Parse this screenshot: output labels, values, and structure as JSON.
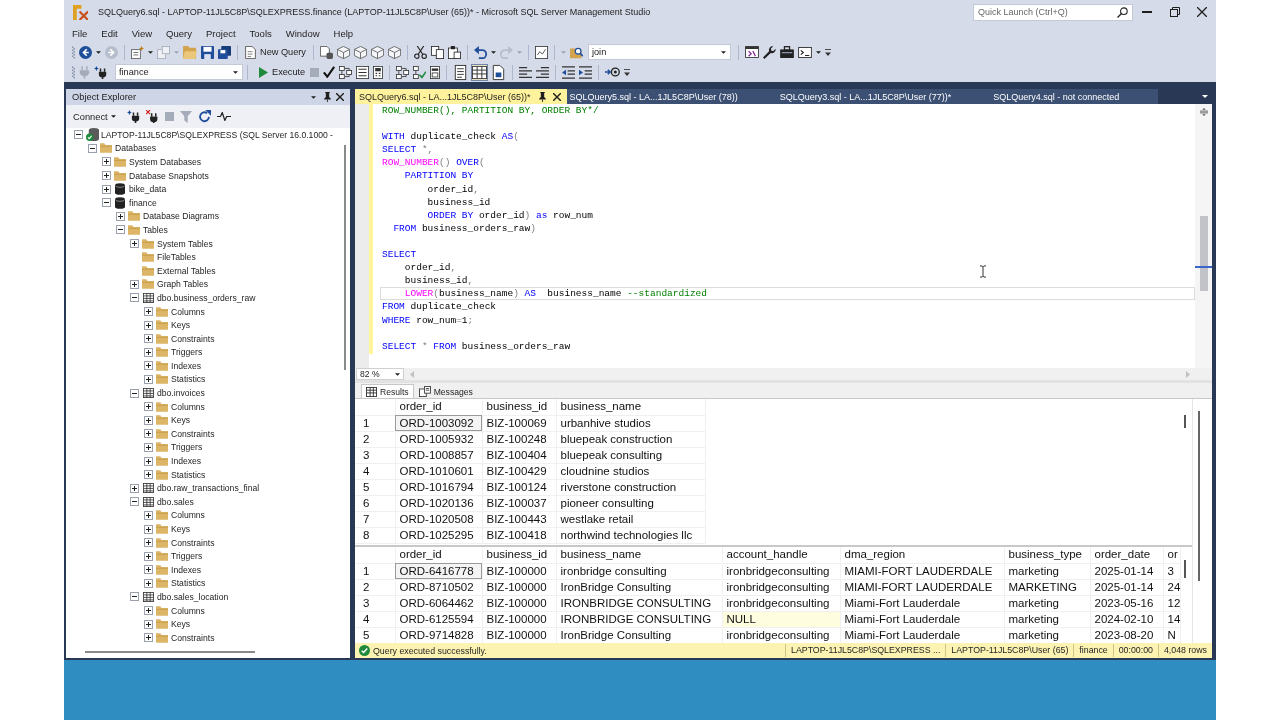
{
  "window": {
    "title": "SQLQuery6.sql - LAPTOP-11JL5C8P\\SQLEXPRESS.finance (LAPTOP-11JL5C8P\\User (65))* - Microsoft SQL Server Management Studio",
    "quick_launch": {
      "placeholder": "Quick Launch (Ctrl+Q)"
    }
  },
  "menu": [
    "File",
    "Edit",
    "View",
    "Query",
    "Project",
    "Tools",
    "Window",
    "Help"
  ],
  "toolbar_1": {
    "new_query_button": "New Query",
    "search_combo": {
      "value": "join"
    }
  },
  "toolbar_2": {
    "database_combo": {
      "value": "finance"
    },
    "execute_button": "Execute",
    "output_modes": [
      {
        "selected": false
      },
      {
        "selected": true
      },
      {
        "selected": false
      }
    ]
  },
  "object_explorer": {
    "title": "Object Explorer",
    "connect_button": "Connect",
    "tree": [
      {
        "label": "LAPTOP-11JL5C8P\\SQLEXPRESS (SQL Server 16.0.1000 -",
        "kind": "server",
        "expanded": true,
        "children": [
          {
            "label": "Databases",
            "kind": "folder",
            "expanded": true,
            "children": [
              {
                "label": "System Databases",
                "kind": "folder",
                "expanded": false
              },
              {
                "label": "Database Snapshots",
                "kind": "folder",
                "expanded": false
              },
              {
                "label": "bike_data",
                "kind": "database",
                "expanded": false
              },
              {
                "label": "finance",
                "kind": "database",
                "expanded": true,
                "children": [
                  {
                    "label": "Database Diagrams",
                    "kind": "folder",
                    "expanded": false
                  },
                  {
                    "label": "Tables",
                    "kind": "folder",
                    "expanded": true,
                    "children": [
                      {
                        "label": "System Tables",
                        "kind": "folder",
                        "expanded": false
                      },
                      {
                        "label": "FileTables",
                        "kind": "folder"
                      },
                      {
                        "label": "External Tables",
                        "kind": "folder"
                      },
                      {
                        "label": "Graph Tables",
                        "kind": "folder",
                        "expanded": false
                      },
                      {
                        "label": "dbo.business_orders_raw",
                        "kind": "table",
                        "expanded": true,
                        "children": [
                          {
                            "label": "Columns",
                            "kind": "folder",
                            "expanded": false
                          },
                          {
                            "label": "Keys",
                            "kind": "folder",
                            "expanded": false
                          },
                          {
                            "label": "Constraints",
                            "kind": "folder",
                            "expanded": false
                          },
                          {
                            "label": "Triggers",
                            "kind": "folder",
                            "expanded": false
                          },
                          {
                            "label": "Indexes",
                            "kind": "folder",
                            "expanded": false
                          },
                          {
                            "label": "Statistics",
                            "kind": "folder",
                            "expanded": false
                          }
                        ]
                      },
                      {
                        "label": "dbo.invoices",
                        "kind": "table",
                        "expanded": true,
                        "children": [
                          {
                            "label": "Columns",
                            "kind": "folder",
                            "expanded": false
                          },
                          {
                            "label": "Keys",
                            "kind": "folder",
                            "expanded": false
                          },
                          {
                            "label": "Constraints",
                            "kind": "folder",
                            "expanded": false
                          },
                          {
                            "label": "Triggers",
                            "kind": "folder",
                            "expanded": false
                          },
                          {
                            "label": "Indexes",
                            "kind": "folder",
                            "expanded": false
                          },
                          {
                            "label": "Statistics",
                            "kind": "folder",
                            "expanded": false
                          }
                        ]
                      },
                      {
                        "label": "dbo.raw_transactions_final",
                        "kind": "table",
                        "expanded": false
                      },
                      {
                        "label": "dbo.sales",
                        "kind": "table",
                        "expanded": true,
                        "children": [
                          {
                            "label": "Columns",
                            "kind": "folder",
                            "expanded": false
                          },
                          {
                            "label": "Keys",
                            "kind": "folder",
                            "expanded": false
                          },
                          {
                            "label": "Constraints",
                            "kind": "folder",
                            "expanded": false
                          },
                          {
                            "label": "Triggers",
                            "kind": "folder",
                            "expanded": false
                          },
                          {
                            "label": "Indexes",
                            "kind": "folder",
                            "expanded": false
                          },
                          {
                            "label": "Statistics",
                            "kind": "folder",
                            "expanded": false
                          }
                        ]
                      },
                      {
                        "label": "dbo.sales_location",
                        "kind": "table",
                        "expanded": true,
                        "children": [
                          {
                            "label": "Columns",
                            "kind": "folder",
                            "expanded": false
                          },
                          {
                            "label": "Keys",
                            "kind": "folder",
                            "expanded": false
                          },
                          {
                            "label": "Constraints",
                            "kind": "folder",
                            "expanded": false
                          }
                        ]
                      }
                    ]
                  }
                ]
              }
            ]
          }
        ]
      }
    ]
  },
  "document_tabs": [
    {
      "label": "SQLQuery6.sql - LA...1JL5C8P\\User (65))*",
      "selected": true
    },
    {
      "label": "SQLQuery5.sql - LA...1JL5C8P\\User (78))",
      "selected": false
    },
    {
      "label": "SQLQuery3.sql - LA...1JL5C8P\\User (77))*",
      "selected": false
    },
    {
      "label": "SQLQuery4.sql - not connected",
      "selected": false
    }
  ],
  "editor": {
    "lines": [
      {
        "current": false,
        "tokens": [
          {
            "text": "ROW_NUMBER(), PARTITION BY, ORDER BY*/",
            "kind": "comment"
          }
        ]
      },
      {
        "current": false
      },
      {
        "current": false,
        "tokens": [
          {
            "text": "WITH",
            "kind": "keyword"
          },
          {
            "text": " duplicate_check ",
            "kind": "text"
          },
          {
            "text": "AS",
            "kind": "keyword"
          },
          {
            "text": "(",
            "kind": "operator"
          }
        ]
      },
      {
        "current": false,
        "tokens": [
          {
            "text": "SELECT",
            "kind": "keyword"
          },
          {
            "text": " *,",
            "kind": "operator"
          }
        ]
      },
      {
        "current": false,
        "tokens": [
          {
            "text": "ROW_NUMBER",
            "kind": "function"
          },
          {
            "text": "() ",
            "kind": "operator"
          },
          {
            "text": "OVER",
            "kind": "keyword"
          },
          {
            "text": "(",
            "kind": "operator"
          }
        ]
      },
      {
        "current": false,
        "tokens": [
          {
            "text": "    PARTITION BY",
            "kind": "keyword"
          }
        ]
      },
      {
        "current": false,
        "tokens": [
          {
            "text": "        order_id",
            "kind": "text"
          },
          {
            "text": ",",
            "kind": "operator"
          }
        ]
      },
      {
        "current": false,
        "tokens": [
          {
            "text": "        business_id",
            "kind": "text"
          }
        ]
      },
      {
        "current": false,
        "tokens": [
          {
            "text": "        ORDER BY",
            "kind": "keyword"
          },
          {
            "text": " order_id",
            "kind": "text"
          },
          {
            "text": ") ",
            "kind": "operator"
          },
          {
            "text": "as",
            "kind": "keyword"
          },
          {
            "text": " row_num",
            "kind": "text"
          }
        ]
      },
      {
        "current": false,
        "tokens": [
          {
            "text": "  FROM",
            "kind": "keyword"
          },
          {
            "text": " business_orders_raw",
            "kind": "text"
          },
          {
            "text": ")",
            "kind": "operator"
          }
        ]
      },
      {
        "current": false
      },
      {
        "current": false,
        "tokens": [
          {
            "text": "SELECT",
            "kind": "keyword"
          }
        ]
      },
      {
        "current": false,
        "tokens": [
          {
            "text": "    order_id",
            "kind": "text"
          },
          {
            "text": ",",
            "kind": "operator"
          }
        ]
      },
      {
        "current": false,
        "tokens": [
          {
            "text": "    business_id",
            "kind": "text"
          },
          {
            "text": ",",
            "kind": "operator"
          }
        ]
      },
      {
        "current": true,
        "tokens": [
          {
            "text": "    LOWER",
            "kind": "function"
          },
          {
            "text": "(",
            "kind": "operator"
          },
          {
            "text": "business_name",
            "kind": "text"
          },
          {
            "text": ") ",
            "kind": "operator"
          },
          {
            "text": "AS",
            "kind": "keyword"
          },
          {
            "text": "  business_name ",
            "kind": "text"
          },
          {
            "text": "--standardized",
            "kind": "comment"
          }
        ]
      },
      {
        "current": false,
        "tokens": [
          {
            "text": "FROM",
            "kind": "keyword"
          },
          {
            "text": " duplicate_check",
            "kind": "text"
          }
        ]
      },
      {
        "current": false,
        "tokens": [
          {
            "text": "WHERE",
            "kind": "keyword"
          },
          {
            "text": " row_num",
            "kind": "text"
          },
          {
            "text": "=",
            "kind": "operator"
          },
          {
            "text": "1",
            "kind": "text"
          },
          {
            "text": ";",
            "kind": "operator"
          }
        ]
      },
      {
        "current": false
      },
      {
        "current": false,
        "tokens": [
          {
            "text": "SELECT",
            "kind": "keyword"
          },
          {
            "text": " * ",
            "kind": "operator"
          },
          {
            "text": "FROM",
            "kind": "keyword"
          },
          {
            "text": " business_orders_raw",
            "kind": "text"
          }
        ]
      }
    ],
    "zoom": "82 %"
  },
  "results": {
    "tabs": [
      {
        "label": "Results",
        "selected": true
      },
      {
        "label": "Messages",
        "selected": false
      }
    ],
    "grids": [
      {
        "columns": [
          "order_id",
          "business_id",
          "business_name"
        ],
        "rows": [
          {
            "number": "1",
            "cells": [
              {
                "text": "ORD-1003092",
                "selected": true,
                "is_null": false
              },
              {
                "text": "BIZ-100069",
                "selected": false,
                "is_null": false
              },
              {
                "text": "urbanhive studios",
                "selected": false,
                "is_null": false
              }
            ]
          },
          {
            "number": "2",
            "cells": [
              {
                "text": "ORD-1005932",
                "selected": false,
                "is_null": false
              },
              {
                "text": "BIZ-100248",
                "selected": false,
                "is_null": false
              },
              {
                "text": "bluepeak construction",
                "selected": false,
                "is_null": false
              }
            ]
          },
          {
            "number": "3",
            "cells": [
              {
                "text": "ORD-1008857",
                "selected": false,
                "is_null": false
              },
              {
                "text": "BIZ-100404",
                "selected": false,
                "is_null": false
              },
              {
                "text": "bluepeak consulting",
                "selected": false,
                "is_null": false
              }
            ]
          },
          {
            "number": "4",
            "cells": [
              {
                "text": "ORD-1010601",
                "selected": false,
                "is_null": false
              },
              {
                "text": "BIZ-100429",
                "selected": false,
                "is_null": false
              },
              {
                "text": "cloudnine studios",
                "selected": false,
                "is_null": false
              }
            ]
          },
          {
            "number": "5",
            "cells": [
              {
                "text": "ORD-1016794",
                "selected": false,
                "is_null": false
              },
              {
                "text": "BIZ-100124",
                "selected": false,
                "is_null": false
              },
              {
                "text": "riverstone construction",
                "selected": false,
                "is_null": false
              }
            ]
          },
          {
            "number": "6",
            "cells": [
              {
                "text": "ORD-1020136",
                "selected": false,
                "is_null": false
              },
              {
                "text": "BIZ-100037",
                "selected": false,
                "is_null": false
              },
              {
                "text": "pioneer consulting",
                "selected": false,
                "is_null": false
              }
            ]
          },
          {
            "number": "7",
            "cells": [
              {
                "text": "ORD-1020508",
                "selected": false,
                "is_null": false
              },
              {
                "text": "BIZ-100443",
                "selected": false,
                "is_null": false
              },
              {
                "text": "westlake retail",
                "selected": false,
                "is_null": false
              }
            ]
          },
          {
            "number": "8",
            "cells": [
              {
                "text": "ORD-1025295",
                "selected": false,
                "is_null": false
              },
              {
                "text": "BIZ-100418",
                "selected": false,
                "is_null": false
              },
              {
                "text": "northwind technologies llc",
                "selected": false,
                "is_null": false
              }
            ]
          }
        ]
      },
      {
        "columns": [
          "order_id",
          "business_id",
          "business_name",
          "account_handle",
          "dma_region",
          "business_type",
          "order_date",
          "or"
        ],
        "rows": [
          {
            "number": "1",
            "cells": [
              {
                "text": "ORD-6416778",
                "selected": true,
                "is_null": false
              },
              {
                "text": "BIZ-100000",
                "selected": false,
                "is_null": false
              },
              {
                "text": "ironbridge consulting",
                "selected": false,
                "is_null": false
              },
              {
                "text": "ironbridgeconsulting",
                "selected": false,
                "is_null": false
              },
              {
                "text": "MIAMI-FORT LAUDERDALE",
                "selected": false,
                "is_null": false
              },
              {
                "text": "marketing",
                "selected": false,
                "is_null": false
              },
              {
                "text": "2025-01-14",
                "selected": false,
                "is_null": false
              },
              {
                "text": "3",
                "selected": false,
                "is_null": false
              }
            ]
          },
          {
            "number": "2",
            "cells": [
              {
                "text": "ORD-8710502",
                "selected": false,
                "is_null": false
              },
              {
                "text": "BIZ-100000",
                "selected": false,
                "is_null": false
              },
              {
                "text": "IronBridge Consulting",
                "selected": false,
                "is_null": false
              },
              {
                "text": "ironbridgeconsulting",
                "selected": false,
                "is_null": false
              },
              {
                "text": "MIAMI-FORT LAUDERDALE",
                "selected": false,
                "is_null": false
              },
              {
                "text": "MARKETING",
                "selected": false,
                "is_null": false
              },
              {
                "text": "2025-01-14",
                "selected": false,
                "is_null": false
              },
              {
                "text": "24",
                "selected": false,
                "is_null": false
              }
            ]
          },
          {
            "number": "3",
            "cells": [
              {
                "text": "ORD-6064462",
                "selected": false,
                "is_null": false
              },
              {
                "text": "BIZ-100000",
                "selected": false,
                "is_null": false
              },
              {
                "text": "IRONBRIDGE CONSULTING",
                "selected": false,
                "is_null": false
              },
              {
                "text": "ironbridgeconsulting",
                "selected": false,
                "is_null": false
              },
              {
                "text": "Miami-Fort Lauderdale",
                "selected": false,
                "is_null": false
              },
              {
                "text": "marketing",
                "selected": false,
                "is_null": false
              },
              {
                "text": "2023-05-16",
                "selected": false,
                "is_null": false
              },
              {
                "text": "12",
                "selected": false,
                "is_null": false
              }
            ]
          },
          {
            "number": "4",
            "cells": [
              {
                "text": "ORD-6125594",
                "selected": false,
                "is_null": false
              },
              {
                "text": "BIZ-100000",
                "selected": false,
                "is_null": false
              },
              {
                "text": "IRONBRIDGE CONSULTING",
                "selected": false,
                "is_null": false
              },
              {
                "text": "NULL",
                "selected": false,
                "is_null": true
              },
              {
                "text": "Miami-Fort Lauderdale",
                "selected": false,
                "is_null": false
              },
              {
                "text": "marketing",
                "selected": false,
                "is_null": false
              },
              {
                "text": "2024-02-10",
                "selected": false,
                "is_null": false
              },
              {
                "text": "14",
                "selected": false,
                "is_null": false
              }
            ]
          },
          {
            "number": "5",
            "cells": [
              {
                "text": "ORD-9714828",
                "selected": false,
                "is_null": false
              },
              {
                "text": "BIZ-100000",
                "selected": false,
                "is_null": false
              },
              {
                "text": "IronBridge Consulting",
                "selected": false,
                "is_null": false
              },
              {
                "text": "ironbridgeconsulting",
                "selected": false,
                "is_null": false
              },
              {
                "text": "Miami-Fort Lauderdale",
                "selected": false,
                "is_null": false
              },
              {
                "text": "marketing",
                "selected": false,
                "is_null": false
              },
              {
                "text": "2023-08-20",
                "selected": false,
                "is_null": false
              },
              {
                "text": "N",
                "selected": false,
                "is_null": false
              }
            ]
          }
        ]
      }
    ]
  },
  "status_bar": {
    "message": "Query executed successfully.",
    "server": "LAPTOP-11JL5C8P\\SQLEXPRESS ...",
    "user": "LAPTOP-11JL5C8P\\User (65)",
    "database": "finance",
    "elapsed": "00:00:00",
    "rows": "4,048 rows"
  }
}
